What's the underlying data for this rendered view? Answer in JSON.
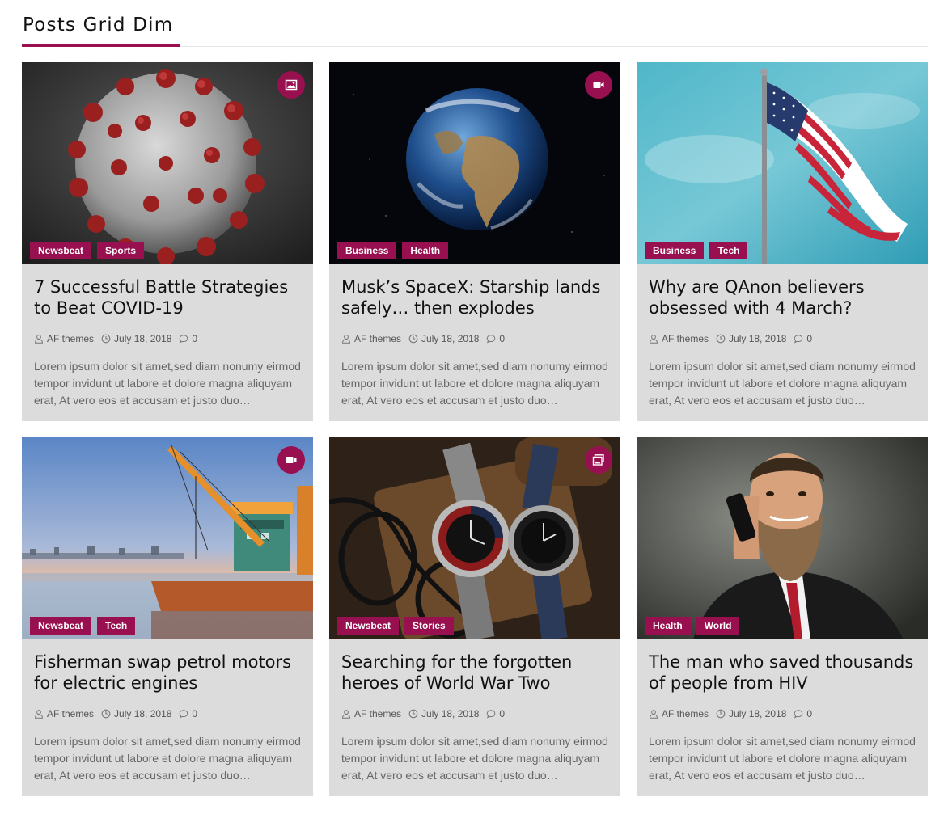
{
  "section": {
    "title": "Posts Grid Dim"
  },
  "colors": {
    "accent": "#98104f",
    "card_background": "#dcdcdc",
    "title_text": "#111111",
    "meta_text": "#555555",
    "excerpt_text": "#666666"
  },
  "posts": [
    {
      "title": "7 Successful Battle Strategies to Beat COVID-19",
      "format_icon": "image-icon",
      "categories": [
        "Newsbeat",
        "Sports"
      ],
      "author": "AF themes",
      "date": "July 18, 2018",
      "comments": "0",
      "excerpt": "Lorem ipsum dolor sit amet,sed diam nonumy eirmod tempor invidunt ut labore et dolore magna aliquyam erat, At vero eos et accusam et justo duo…",
      "image": "coronavirus-image"
    },
    {
      "title": "Musk’s SpaceX: Starship lands safely… then explodes",
      "format_icon": "video-icon",
      "categories": [
        "Business",
        "Health"
      ],
      "author": "AF themes",
      "date": "July 18, 2018",
      "comments": "0",
      "excerpt": "Lorem ipsum dolor sit amet,sed diam nonumy eirmod tempor invidunt ut labore et dolore magna aliquyam erat, At vero eos et accusam et justo duo…",
      "image": "earth-image"
    },
    {
      "title": "Why are QAnon believers obsessed with 4 March?",
      "format_icon": "",
      "categories": [
        "Business",
        "Tech"
      ],
      "author": "AF themes",
      "date": "July 18, 2018",
      "comments": "0",
      "excerpt": "Lorem ipsum dolor sit amet,sed diam nonumy eirmod tempor invidunt ut labore et dolore magna aliquyam erat, At vero eos et accusam et justo duo…",
      "image": "us-flag-image"
    },
    {
      "title": "Fisherman swap petrol motors for electric engines",
      "format_icon": "video-icon",
      "categories": [
        "Newsbeat",
        "Tech"
      ],
      "author": "AF themes",
      "date": "July 18, 2018",
      "comments": "0",
      "excerpt": "Lorem ipsum dolor sit amet,sed diam nonumy eirmod tempor invidunt ut labore et dolore magna aliquyam erat, At vero eos et accusam et justo duo…",
      "image": "crane-barge-image"
    },
    {
      "title": "Searching for the forgotten heroes of World War Two",
      "format_icon": "gallery-icon",
      "categories": [
        "Newsbeat",
        "Stories"
      ],
      "author": "AF themes",
      "date": "July 18, 2018",
      "comments": "0",
      "excerpt": "Lorem ipsum dolor sit amet,sed diam nonumy eirmod tempor invidunt ut labore et dolore magna aliquyam erat, At vero eos et accusam et justo duo…",
      "image": "watches-image"
    },
    {
      "title": "The man who saved thousands of people from HIV",
      "format_icon": "",
      "categories": [
        "Health",
        "World"
      ],
      "author": "AF themes",
      "date": "July 18, 2018",
      "comments": "0",
      "excerpt": "Lorem ipsum dolor sit amet,sed diam nonumy eirmod tempor invidunt ut labore et dolore magna aliquyam erat, At vero eos et accusam et justo duo…",
      "image": "bearded-man-image"
    }
  ]
}
